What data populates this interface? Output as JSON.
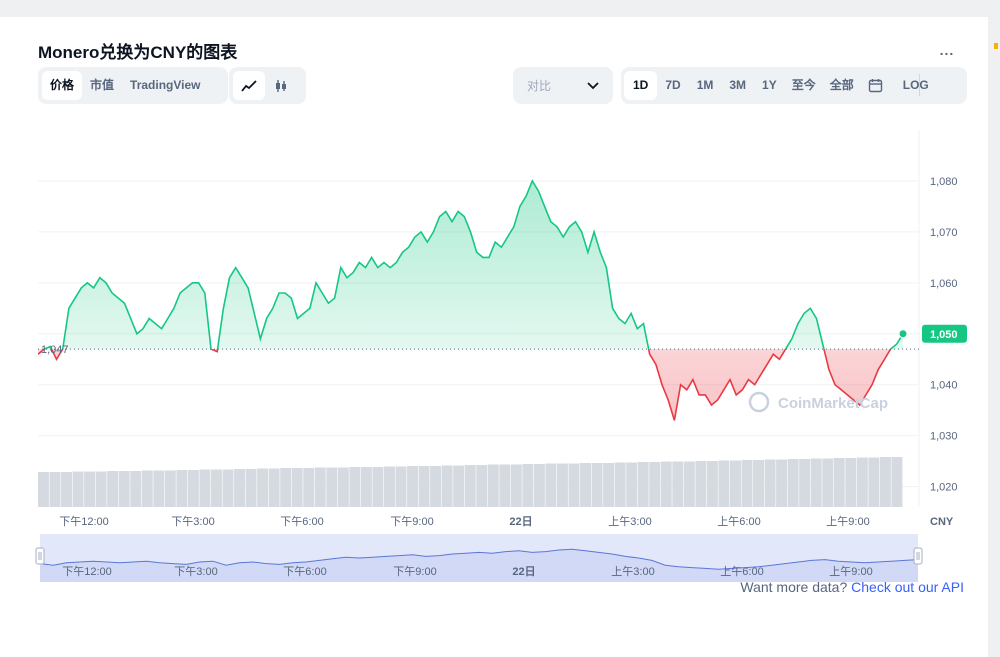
{
  "title": "Monero兑换为CNY的图表",
  "menu_icon": "more-dots-icon",
  "more_label": "...",
  "view_tabs": [
    {
      "label": "价格",
      "active": true
    },
    {
      "label": "市值",
      "active": false
    },
    {
      "label": "TradingView",
      "active": false
    }
  ],
  "chart_type_icons": [
    "line-chart-icon",
    "candlestick-icon"
  ],
  "compare": {
    "label": "对比",
    "icon": "chevron-down-icon"
  },
  "ranges": [
    {
      "label": "1D",
      "active": true
    },
    {
      "label": "7D",
      "active": false
    },
    {
      "label": "1M",
      "active": false
    },
    {
      "label": "3M",
      "active": false
    },
    {
      "label": "1Y",
      "active": false
    },
    {
      "label": "至今",
      "active": false
    },
    {
      "label": "全部",
      "active": false
    }
  ],
  "calendar_icon": "calendar-icon",
  "log_label": "LOG",
  "watermark": "CoinMarketCap",
  "footer": {
    "text": "Want more data?",
    "link": "Check out our API"
  },
  "colors": {
    "up": "#16c784",
    "down": "#ea3943",
    "accent": "#3861fb",
    "nav": "#5a77d8"
  },
  "chart_data": {
    "type": "line",
    "currency": "CNY",
    "ylim": [
      1016,
      1090
    ],
    "yticks": [
      1020,
      1030,
      1040,
      1050,
      1060,
      1070,
      1080
    ],
    "ytick_labels": [
      "1,020",
      "1,030",
      "1,040",
      "1,050",
      "1,060",
      "1,070",
      "1,080"
    ],
    "x_tick_labels": [
      "下午12:00",
      "下午3:00",
      "下午6:00",
      "下午9:00",
      "22日",
      "上午3:00",
      "上午6:00",
      "上午9:00"
    ],
    "reference_value": 1047,
    "reference_label": "1,047",
    "current_value": 1050,
    "current_label": "1,050",
    "price_series": [
      1046,
      1047,
      1047.5,
      1045,
      1047,
      1055,
      1057,
      1059,
      1060,
      1059,
      1061,
      1060,
      1058,
      1057,
      1056,
      1053,
      1050,
      1051,
      1053,
      1052,
      1051,
      1053,
      1055,
      1058,
      1059,
      1060,
      1060,
      1058,
      1047,
      1046.5,
      1055,
      1061,
      1063,
      1061,
      1059,
      1054,
      1049,
      1053,
      1055,
      1058,
      1058,
      1057,
      1053,
      1054,
      1055,
      1060,
      1058,
      1056,
      1057,
      1063,
      1061,
      1062,
      1064,
      1063,
      1065,
      1063,
      1064,
      1063,
      1064,
      1066,
      1067,
      1069,
      1070,
      1068,
      1070,
      1073,
      1074,
      1072,
      1074,
      1073,
      1070,
      1066,
      1065,
      1065,
      1068,
      1067,
      1069,
      1071,
      1075,
      1077,
      1080,
      1078,
      1075,
      1072,
      1071,
      1069,
      1071,
      1072,
      1070,
      1066,
      1070,
      1066,
      1063,
      1055,
      1053,
      1052,
      1054,
      1051,
      1052,
      1046,
      1044,
      1040,
      1037,
      1033,
      1040,
      1039,
      1041,
      1038,
      1038,
      1036,
      1037,
      1039,
      1041,
      1038,
      1039,
      1041,
      1040,
      1042,
      1044,
      1046,
      1045,
      1047,
      1049,
      1052,
      1054,
      1055,
      1053,
      1048,
      1043,
      1040,
      1039,
      1038,
      1037,
      1036,
      1038,
      1040,
      1043,
      1045,
      1047,
      1048,
      1050
    ],
    "volume_series": [
      0.7,
      0.7,
      0.7,
      0.71,
      0.71,
      0.71,
      0.72,
      0.72,
      0.72,
      0.73,
      0.73,
      0.73,
      0.74,
      0.74,
      0.75,
      0.75,
      0.75,
      0.76,
      0.76,
      0.77,
      0.77,
      0.78,
      0.78,
      0.78,
      0.79,
      0.79,
      0.79,
      0.8,
      0.8,
      0.8,
      0.81,
      0.81,
      0.82,
      0.82,
      0.82,
      0.83,
      0.83,
      0.84,
      0.84,
      0.85,
      0.85,
      0.85,
      0.86,
      0.86,
      0.87,
      0.87,
      0.87,
      0.88,
      0.88,
      0.88,
      0.89,
      0.89,
      0.9,
      0.9,
      0.91,
      0.91,
      0.91,
      0.92,
      0.92,
      0.93,
      0.93,
      0.94,
      0.94,
      0.95,
      0.95,
      0.96,
      0.96,
      0.97,
      0.97,
      0.98,
      0.98,
      0.99,
      0.99,
      1.0,
      1.0
    ],
    "navigator_series": [
      1048,
      1046,
      1049,
      1050,
      1051,
      1050,
      1049,
      1050,
      1051,
      1049,
      1048,
      1047,
      1050,
      1051,
      1046,
      1049,
      1050,
      1048,
      1047,
      1049,
      1050,
      1052,
      1054,
      1056,
      1055,
      1056,
      1057,
      1058,
      1059,
      1057,
      1058,
      1060,
      1061,
      1062,
      1061,
      1063,
      1064,
      1062,
      1063,
      1065,
      1066,
      1064,
      1062,
      1060,
      1057,
      1055,
      1052,
      1046,
      1044,
      1043,
      1042,
      1041,
      1042,
      1043,
      1044,
      1046,
      1048,
      1050,
      1052,
      1053,
      1051,
      1050,
      1049,
      1050,
      1051,
      1052,
      1053
    ]
  }
}
